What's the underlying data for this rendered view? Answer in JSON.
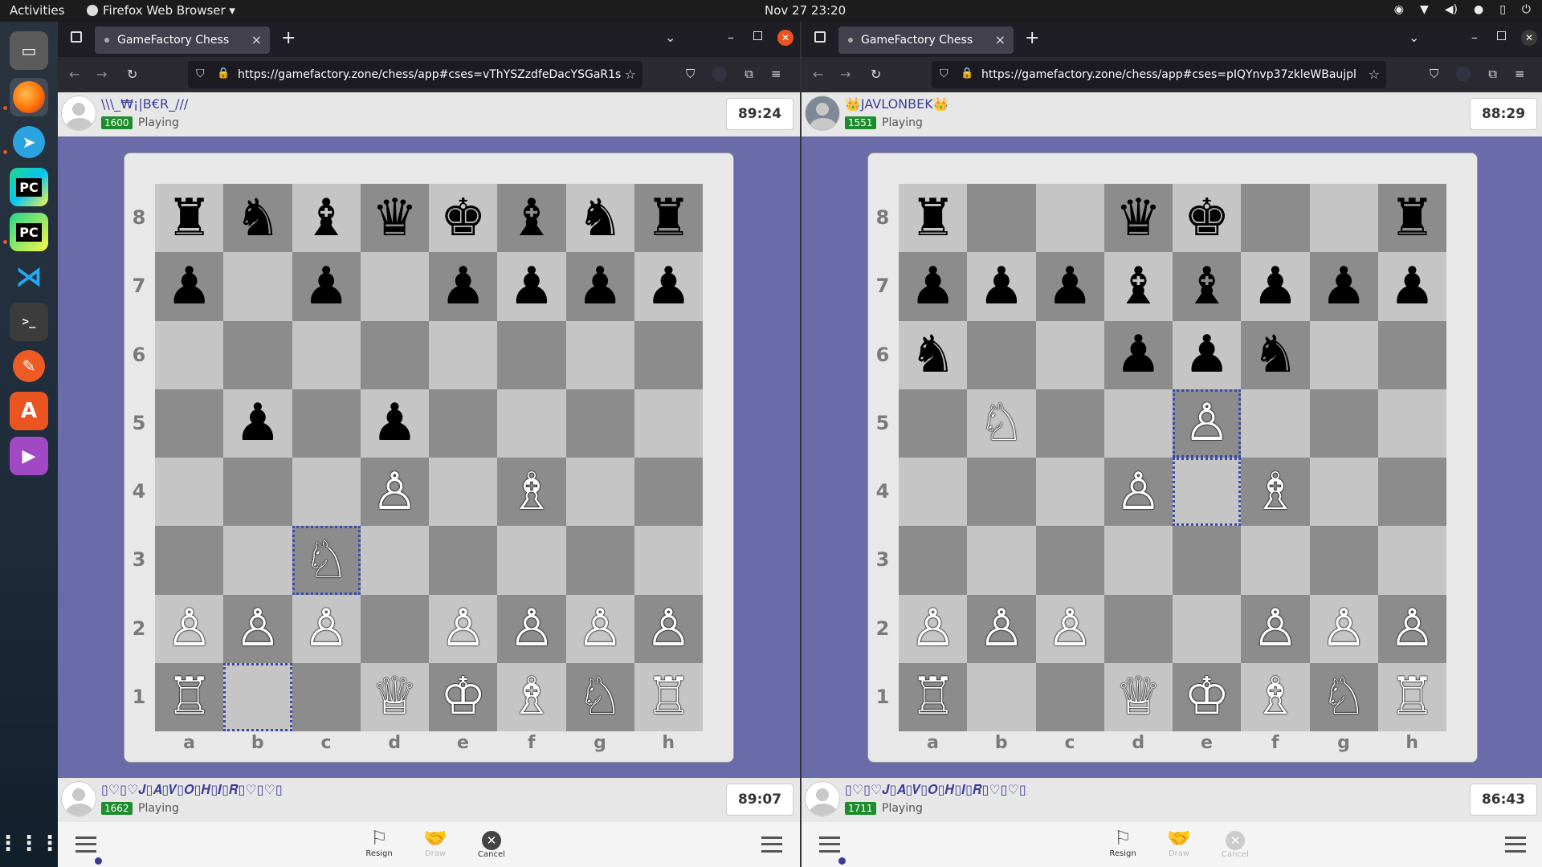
{
  "topbar": {
    "activities": "Activities",
    "app": "Firefox Web Browser ▾",
    "clock": "Nov 27  23:20"
  },
  "dock": {
    "items": [
      "files-icon",
      "firefox-icon",
      "telegram-icon",
      "pycharm-icon",
      "pycharm-community-icon",
      "vscode-icon",
      "terminal-icon",
      "postman-icon",
      "software-icon",
      "media-player-icon",
      "apps-grid-icon"
    ]
  },
  "windows": [
    {
      "tab_title": "GameFactory Chess",
      "url": "https://gamefactory.zone/chess/app#cses=vThYSZzdfeDacYSGaR1s",
      "top_player": {
        "name": "\\\\\\_₩¡|B€R_///",
        "rating": "1600",
        "status": "Playing",
        "time": "89:24"
      },
      "bottom_player": {
        "name": "▯♡▯♡𝑱▯𝑨▯𝑽▯𝑶▯𝑯▯𝑰▯𝑹▯♡▯♡▯",
        "rating": "1662",
        "status": "Playing",
        "time": "89:07"
      },
      "board": [
        "rnbqkbnr",
        "p.p.pppp",
        "........",
        ".p.p....",
        "...P.B..",
        "..N.....",
        "PPP.PPPP",
        "R..QKBNR"
      ],
      "highlights": [
        "c3",
        "b1"
      ],
      "controls": {
        "resign": "Resign",
        "draw": "Draw",
        "cancel": "Cancel",
        "cancel_enabled": true
      }
    },
    {
      "tab_title": "GameFactory Chess",
      "url": "https://gamefactory.zone/chess/app#cses=pIQYnvp37zkleWBaujpl",
      "top_player": {
        "name": "👑JAVLONBEK👑",
        "rating": "1551",
        "status": "Playing",
        "time": "88:29"
      },
      "bottom_player": {
        "name": "▯♡▯♡𝑱▯𝑨▯𝑽▯𝑶▯𝑯▯𝑰▯𝑹▯♡▯♡▯",
        "rating": "1711",
        "status": "Playing",
        "time": "86:43"
      },
      "board": [
        "r..qk..r",
        "pppbbppp",
        "n..ppn..",
        ".N..P...",
        "...P.B..",
        "........",
        "PPP..PPP",
        "R..QKBNR"
      ],
      "highlights": [
        "e5",
        "e4"
      ],
      "controls": {
        "resign": "Resign",
        "draw": "Draw",
        "cancel": "Cancel",
        "cancel_enabled": false
      }
    }
  ],
  "ranks": [
    "8",
    "7",
    "6",
    "5",
    "4",
    "3",
    "2",
    "1"
  ],
  "files": [
    "a",
    "b",
    "c",
    "d",
    "e",
    "f",
    "g",
    "h"
  ]
}
